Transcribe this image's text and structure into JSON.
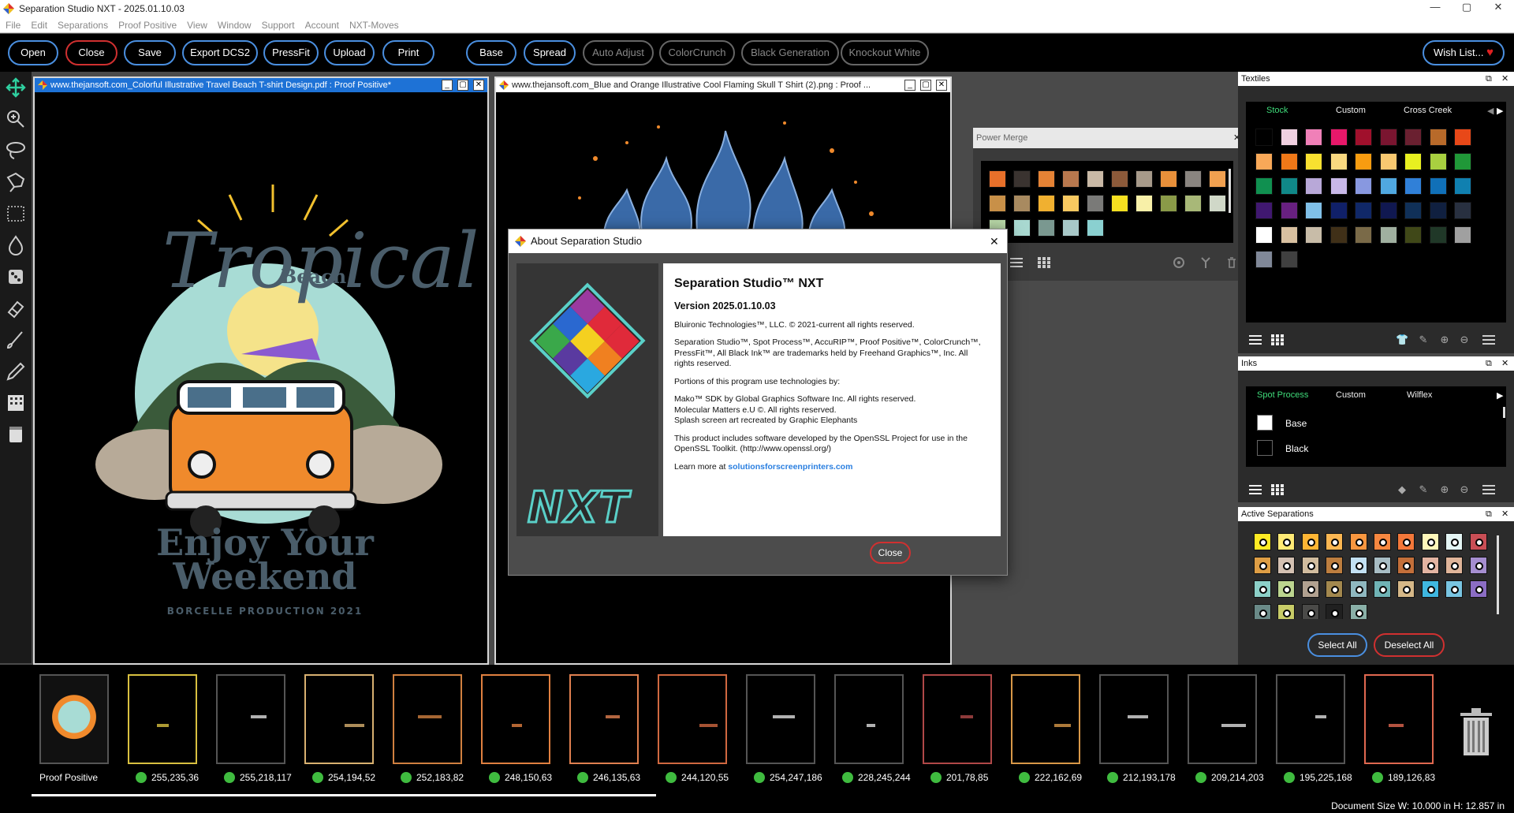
{
  "window": {
    "title": "Separation Studio NXT - 2025.01.10.03",
    "min": "—",
    "max": "▢",
    "close": "✕"
  },
  "menu": [
    "File",
    "Edit",
    "Separations",
    "Proof Positive",
    "View",
    "Window",
    "Support",
    "Account",
    "NXT-Moves"
  ],
  "toolbar": {
    "open": "Open",
    "close": "Close",
    "save": "Save",
    "export": "Export DCS2",
    "pressfit": "PressFit",
    "upload": "Upload",
    "print": "Print",
    "base": "Base",
    "spread": "Spread",
    "auto_adjust": "Auto Adjust",
    "colorcrunch": "ColorCrunch",
    "black_generation": "Black Generation",
    "knockout_white": "Knockout White",
    "wishlist": "Wish List...",
    "heart": "♥"
  },
  "doc1": {
    "title": "www.thejansoft.com_Colorful Illustrative Travel Beach T-shirt Design.pdf : Proof Positive*",
    "art": {
      "line1": "Tropical",
      "line2": "Beach",
      "line3": "Enjoy Your",
      "line4": "Weekend",
      "line5": "BORCELLE PRODUCTION 2021"
    }
  },
  "doc2": {
    "title": "www.thejansoft.com_Blue and Orange Illustrative Cool Flaming Skull T Shirt (2).png : Proof ..."
  },
  "power_merge": {
    "title": "Power Merge",
    "close": "✕",
    "swatches": [
      "#e8702a",
      "#3a3330",
      "#e48235",
      "#b8784e",
      "#c9b9a6",
      "#8c5a3a",
      "#a79a8a",
      "#e8903a",
      "#8a8580",
      "#f0a050",
      "#c89048",
      "#a88a60",
      "#f0b030",
      "#f8c860",
      "#7a7a78",
      "#f6e020",
      "#f8f0a8",
      "#8a9a48",
      "#a8b878",
      "#d0d8c8",
      "#b8d8a8",
      "#a8d8d0",
      "#7a9890",
      "#a8c8c8",
      "#8ad0d0"
    ]
  },
  "textiles": {
    "title": "Textiles",
    "tabs": [
      "Stock",
      "Custom",
      "Cross Creek"
    ],
    "swatches": [
      "#000000",
      "#f0d0e0",
      "#f080b8",
      "#e8186a",
      "#a0102c",
      "#7a1530",
      "#6a2030",
      "#b86a2a",
      "#e84818",
      "#f8a858",
      "#f07818",
      "#f8e030",
      "#f8d880",
      "#f89c10",
      "#f8c870",
      "#e8f020",
      "#a8d040",
      "#209838",
      "#109050",
      "#108888",
      "#b8a8d8",
      "#c8b8e8",
      "#8898e0",
      "#50a8e0",
      "#3080d8",
      "#1070b8",
      "#1080b0",
      "#401870",
      "#682080",
      "#80c0e8",
      "#102068",
      "#102868",
      "#101850",
      "#103058",
      "#102040",
      "#283040",
      "#ffffff",
      "#d8c0a0",
      "#c8bca8",
      "#403018",
      "#7a6a48",
      "#a0b0a0",
      "#404818",
      "#203828",
      "#a0a0a0",
      "#808898",
      "#404040"
    ]
  },
  "inks": {
    "title": "Inks",
    "tabs": [
      "Spot Process",
      "Custom",
      "Wilflex"
    ],
    "items": [
      {
        "name": "Base",
        "color": "#ffffff"
      },
      {
        "name": "Black",
        "color": "#000000"
      }
    ]
  },
  "active_separations": {
    "title": "Active Separations",
    "select_all": "Select All",
    "deselect_all": "Deselect All",
    "swatches": [
      "#ffeb24",
      "#ffea75",
      "#feb534",
      "#fcb752",
      "#f8963f",
      "#f68740",
      "#f4783a",
      "#fff7ba",
      "#e4f5f4",
      "#c94e55",
      "#de9e45",
      "#d4c1b2",
      "#d1bc9e",
      "#bd7e3f",
      "#c3e1f3",
      "#a8bdc4",
      "#c36f3a",
      "#e3b4a2",
      "#e0b59a",
      "#a58ed0",
      "#8cd0c8",
      "#bcd58f",
      "#b1a190",
      "#a3884e",
      "#8fb8c0",
      "#6fb3b5",
      "#d6b888",
      "#3fb7e0",
      "#79c5e2",
      "#8b6dc4",
      "#6a8a88",
      "#c8cc68",
      "#4a4a48",
      "#202020",
      "#8ab0a8"
    ]
  },
  "filmstrip": {
    "labels": [
      "Proof Positive",
      "255,235,36",
      "255,218,117",
      "254,194,52",
      "252,183,82",
      "248,150,63",
      "246,135,63",
      "244,120,55",
      "254,247,186",
      "228,245,244",
      "201,78,85",
      "222,162,69",
      "212,193,178",
      "209,214,203",
      "195,225,168",
      "189,126,83"
    ],
    "borders": [
      "#555555",
      "#d8c040",
      "#555555",
      "#d8b070",
      "#d08040",
      "#e08040",
      "#e08050",
      "#d06840",
      "#555555",
      "#555555",
      "#b04848",
      "#d89848",
      "#555555",
      "#555555",
      "#555555",
      "#e06850"
    ]
  },
  "status": "Document Size W: 10.000 in H: 12.857 in",
  "about": {
    "title": "About Separation Studio",
    "close_x": "✕",
    "product": "Separation Studio™ NXT",
    "version": "Version 2025.01.10.03",
    "p1": "Bluironic Technologies™, LLC. © 2021-current all rights reserved.",
    "p2": "Separation Studio™, Spot Process™, AccuRIP™, Proof Positive™, ColorCrunch™, PressFit™, All Black Ink™ are trademarks held by Freehand Graphics™, Inc. All rights reserved.",
    "p3": "Portions of this program use technologies by:",
    "p4a": "Mako™ SDK by Global Graphics Software Inc. All rights reserved.",
    "p4b": "Molecular Matters e.U ©. All rights reserved.",
    "p4c": "Splash screen art recreated by Graphic Elephants",
    "p5": "This product includes software developed by the OpenSSL Project for use in the OpenSSL Toolkit. (http://www.openssl.org/)",
    "p6_prefix": "Learn more at ",
    "p6_link": "solutionsforscreenprinters.com",
    "nxt": "NXT",
    "close_button": "Close"
  }
}
